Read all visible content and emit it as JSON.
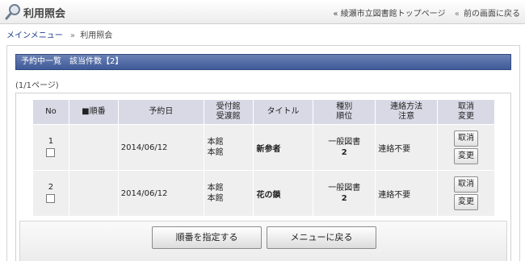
{
  "header": {
    "title": "利用照会",
    "icon": "magnifier-icon",
    "links": [
      {
        "prefix": "«",
        "label": "綾瀬市立図書館トップページ"
      },
      {
        "prefix": "«",
        "label": "前の画面に戻る"
      }
    ]
  },
  "breadcrumb": {
    "home": "メインメニュー",
    "separator": "»",
    "current": "利用照会"
  },
  "section": {
    "heading": "予約中一覧　該当件数【2】",
    "page_info": "(1/1ページ)"
  },
  "table": {
    "headers": {
      "no": "No",
      "order": "■順番",
      "date": "予約日",
      "branch_l1": "受付館",
      "branch_l2": "受渡館",
      "title": "タイトル",
      "type_l1": "種別",
      "type_l2": "順位",
      "contact_l1": "連絡方法",
      "contact_l2": "注意",
      "action_l1": "取消",
      "action_l2": "変更"
    },
    "rows": [
      {
        "no": "1",
        "order": "",
        "date": "2014/06/12",
        "receive_branch": "本館",
        "deliver_branch": "本館",
        "title": "新参者",
        "type": "一般図書",
        "rank": "2",
        "contact": "連絡不要",
        "cancel_label": "取消",
        "change_label": "変更"
      },
      {
        "no": "2",
        "order": "",
        "date": "2014/06/12",
        "receive_branch": "本館",
        "deliver_branch": "本館",
        "title": "花の鎖",
        "type": "一般図書",
        "rank": "2",
        "contact": "連絡不要",
        "cancel_label": "取消",
        "change_label": "変更"
      }
    ]
  },
  "buttons": {
    "set_order": "順番を指定する",
    "back_to_menu": "メニューに戻る"
  },
  "colors": {
    "section_bar": "#4a65a3",
    "header_cell": "#d9d9e6",
    "body_cell": "#efefef"
  }
}
